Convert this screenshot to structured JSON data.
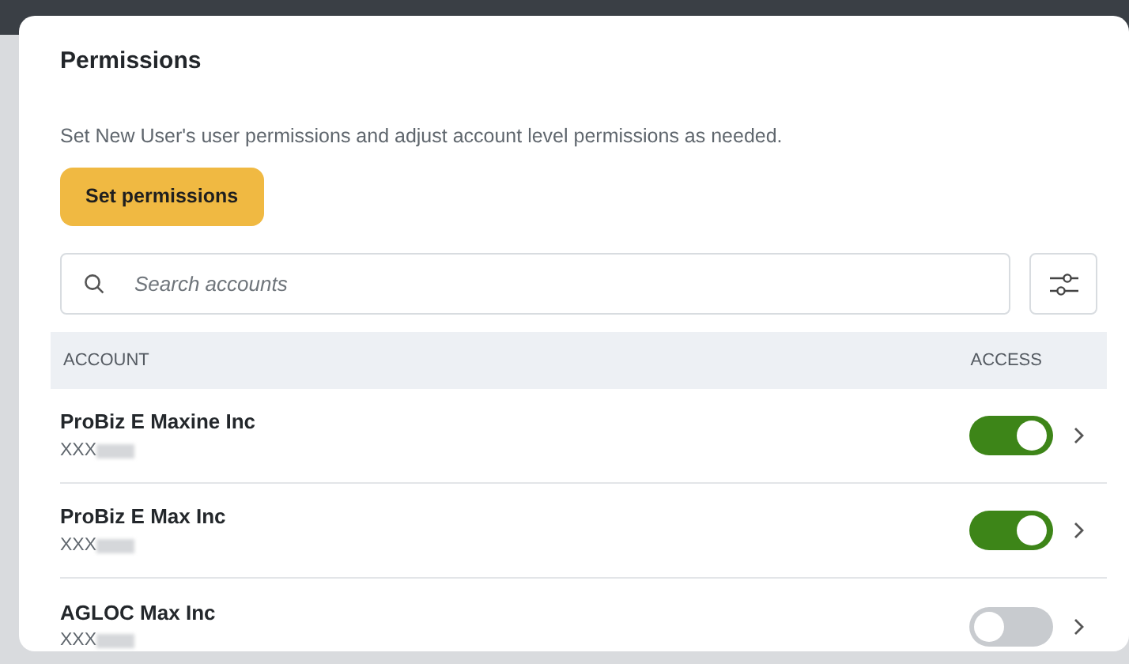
{
  "panel": {
    "title": "Permissions",
    "description": "Set New User's user permissions and adjust account level permissions as needed.",
    "primary_button": "Set permissions"
  },
  "search": {
    "placeholder": "Search accounts"
  },
  "table": {
    "columns": [
      "ACCOUNT",
      "ACCESS"
    ],
    "rows": [
      {
        "name": "ProBiz E Maxine Inc",
        "number": "XXX",
        "access": true
      },
      {
        "name": "ProBiz E Max Inc",
        "number": "XXX",
        "access": true
      },
      {
        "name": "AGLOC Max Inc",
        "number": "XXX",
        "access": false
      }
    ]
  }
}
